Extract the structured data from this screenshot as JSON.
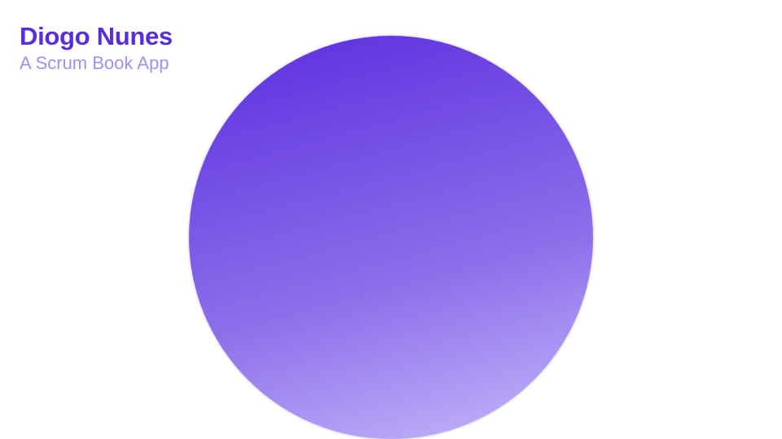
{
  "header": {
    "title": "Diogo Nunes",
    "subtitle": "A Scrum Book App"
  },
  "colors": {
    "title": "#5b2be0",
    "subtitle": "#a58ef0",
    "circle_gradient_start": "#5a2ddf",
    "circle_gradient_mid": "#8d6fea",
    "circle_gradient_end": "#c6b9fb",
    "background": "#ffffff"
  }
}
